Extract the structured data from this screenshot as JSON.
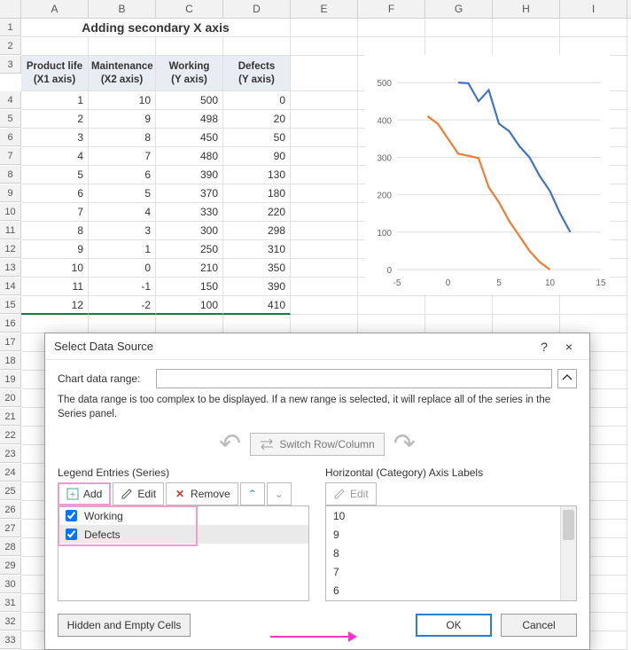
{
  "columns": [
    "A",
    "B",
    "C",
    "D",
    "E",
    "F",
    "G",
    "H",
    "I"
  ],
  "title": "Adding secondary X axis",
  "table": {
    "headers": [
      {
        "h1": "Product life",
        "h2": "(X1 axis)"
      },
      {
        "h1": "Maintenance",
        "h2": "(X2 axis)"
      },
      {
        "h1": "Working",
        "h2": "(Y axis)"
      },
      {
        "h1": "Defects",
        "h2": "(Y axis)"
      }
    ],
    "rows": [
      [
        "1",
        "10",
        "500",
        "0"
      ],
      [
        "2",
        "9",
        "498",
        "20"
      ],
      [
        "3",
        "8",
        "450",
        "50"
      ],
      [
        "4",
        "7",
        "480",
        "90"
      ],
      [
        "5",
        "6",
        "390",
        "130"
      ],
      [
        "6",
        "5",
        "370",
        "180"
      ],
      [
        "7",
        "4",
        "330",
        "220"
      ],
      [
        "8",
        "3",
        "300",
        "298"
      ],
      [
        "9",
        "1",
        "250",
        "310"
      ],
      [
        "10",
        "0",
        "210",
        "350"
      ],
      [
        "11",
        "-1",
        "150",
        "390"
      ],
      [
        "12",
        "-2",
        "100",
        "410"
      ]
    ]
  },
  "chart_data": {
    "type": "line",
    "x": [
      -2,
      -1,
      0,
      1,
      2,
      3,
      4,
      5,
      6,
      7,
      8,
      9,
      10,
      11,
      12
    ],
    "x_ticks": [
      -5,
      0,
      5,
      10,
      15
    ],
    "y_ticks": [
      0,
      100,
      200,
      300,
      400,
      500
    ],
    "ylim": [
      0,
      550
    ],
    "xlim": [
      -5,
      15
    ],
    "series": [
      {
        "name": "Working",
        "color": "#4472c4",
        "x": [
          1,
          2,
          3,
          4,
          5,
          6,
          7,
          8,
          9,
          10,
          11,
          12
        ],
        "y": [
          500,
          498,
          450,
          480,
          390,
          370,
          330,
          300,
          250,
          210,
          150,
          100
        ]
      },
      {
        "name": "Defects",
        "color": "#ed7d31",
        "x": [
          -2,
          -1,
          0,
          1,
          3,
          4,
          5,
          6,
          7,
          8,
          9,
          10
        ],
        "y": [
          410,
          390,
          350,
          310,
          298,
          220,
          180,
          130,
          90,
          50,
          20,
          0
        ]
      }
    ]
  },
  "dialog": {
    "title": "Select Data Source",
    "help": "?",
    "close": "×",
    "chart_range_label": "Chart data range:",
    "msg": "The data range is too complex to be displayed. If a new range is selected, it will replace all of the series in the Series panel.",
    "switch": "Switch Row/Column",
    "legend_title": "Legend Entries (Series)",
    "horiz_title": "Horizontal (Category) Axis Labels",
    "add": "Add",
    "edit": "Edit",
    "remove": "Remove",
    "series": [
      {
        "label": "Working"
      },
      {
        "label": "Defects",
        "selected": true
      }
    ],
    "categories": [
      "10",
      "9",
      "8",
      "7",
      "6"
    ],
    "hidden_empty": "Hidden and Empty Cells",
    "ok": "OK",
    "cancel": "Cancel"
  },
  "row_count": 33
}
